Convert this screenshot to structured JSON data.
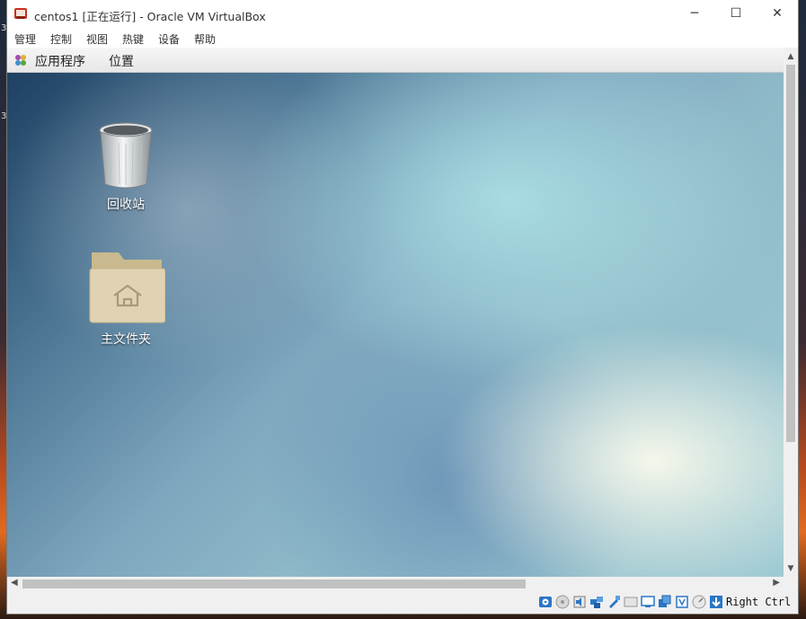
{
  "host_edge": {
    "digit_1": "3",
    "digit_2": "3"
  },
  "window": {
    "title": "centos1 [正在运行] - Oracle VM VirtualBox",
    "controls": {
      "minimize": "─",
      "maximize": "☐",
      "close": "✕"
    }
  },
  "menu": {
    "items": [
      "管理",
      "控制",
      "视图",
      "热键",
      "设备",
      "帮助"
    ]
  },
  "guest": {
    "topbar": {
      "applications": "应用程序",
      "places": "位置"
    },
    "desktop_icons": [
      {
        "label": "回收站",
        "icon": "trash-icon"
      },
      {
        "label": "主文件夹",
        "icon": "home-folder-icon"
      }
    ]
  },
  "scrollbars": {
    "up": "▲",
    "down": "▼",
    "left": "◀",
    "right": "▶"
  },
  "statusbar": {
    "icons": [
      "hard-disk-icon",
      "optical-drive-icon",
      "audio-icon",
      "network-icon",
      "usb-icon",
      "shared-folders-icon",
      "display-icon",
      "video-capture-icon",
      "cpu-icon",
      "mouse-integration-icon",
      "keyboard-icon"
    ],
    "host_key": "Right Ctrl"
  },
  "colors": {
    "window_bg": "#ffffff",
    "guest_topbar": "#ececec",
    "desktop_teal": "#9fcbd4",
    "folder": "#ddd0b0"
  }
}
